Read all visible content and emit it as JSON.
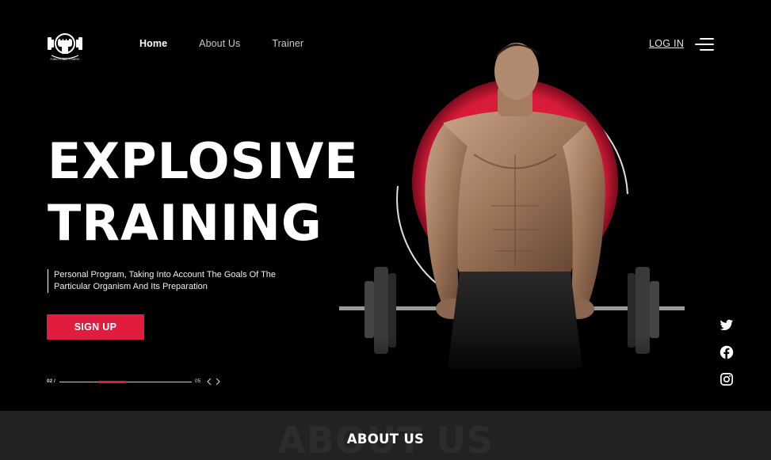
{
  "brand": {
    "logo_icon": "fist-dumbbell-logo",
    "logo_text": "FUNCTIONAL FITNESS"
  },
  "nav": {
    "items": [
      {
        "label": "Home",
        "active": true
      },
      {
        "label": "About Us",
        "active": false
      },
      {
        "label": "Trainer",
        "active": false
      }
    ],
    "login_label": "LOG IN",
    "menu_icon": "hamburger-menu-icon"
  },
  "hero": {
    "headline_line1": "EXPLOSIVE",
    "headline_line2": "TRAINING",
    "subtext": "Personal Program, Taking Into Account The Goals Of The Particular Organism And Its Preparation",
    "cta_label": "SIGN UP",
    "image_alt": "muscular man lifting barbell with red circle backdrop"
  },
  "slider": {
    "current": "02 /",
    "total": "05",
    "progress": 0.4,
    "prev_icon": "chevron-left-icon",
    "next_icon": "chevron-right-icon"
  },
  "social": [
    "twitter-icon",
    "facebook-icon",
    "instagram-icon"
  ],
  "about": {
    "ghost_text": "ABOUT US",
    "title": "ABOUT US"
  },
  "colors": {
    "accent": "#e11d3f",
    "background": "#000000",
    "section_bg": "#222222"
  }
}
